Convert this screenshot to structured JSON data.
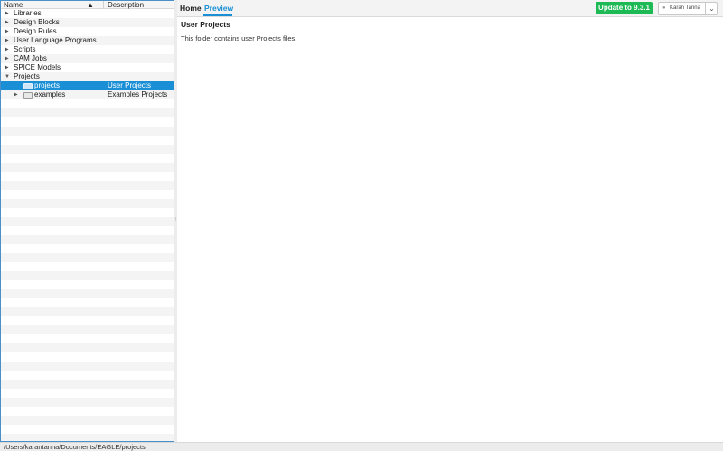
{
  "tree": {
    "header": {
      "name": "Name",
      "sort_indicator": "▲",
      "description": "Description"
    },
    "items": [
      {
        "label": "Libraries",
        "description": "",
        "arrow": "▶"
      },
      {
        "label": "Design Blocks",
        "description": "",
        "arrow": "▶"
      },
      {
        "label": "Design Rules",
        "description": "",
        "arrow": "▶"
      },
      {
        "label": "User Language Programs",
        "description": "",
        "arrow": "▶"
      },
      {
        "label": "Scripts",
        "description": "",
        "arrow": "▶"
      },
      {
        "label": "CAM Jobs",
        "description": "",
        "arrow": "▶"
      },
      {
        "label": "SPICE Models",
        "description": "",
        "arrow": "▶"
      },
      {
        "label": "Projects",
        "description": "",
        "arrow": "▼"
      }
    ],
    "children": [
      {
        "label": "projects",
        "description": "User Projects",
        "selected": true
      },
      {
        "label": "examples",
        "description": "Examples Projects",
        "arrow": "▶"
      }
    ]
  },
  "tabs": {
    "home": "Home",
    "preview": "Preview"
  },
  "update_button": "Update to 9.3.1",
  "user": {
    "name": "Karan Tanna",
    "icon": "person-icon",
    "chevron": "⌄"
  },
  "content": {
    "title": "User Projects",
    "body": "This folder contains user Projects files."
  },
  "status_bar": {
    "path": "/Users/karantanna/Documents/EAGLE/projects"
  },
  "colors": {
    "accent": "#1a8fd6",
    "update_green": "#1db954",
    "selection": "#1a8fd6"
  }
}
